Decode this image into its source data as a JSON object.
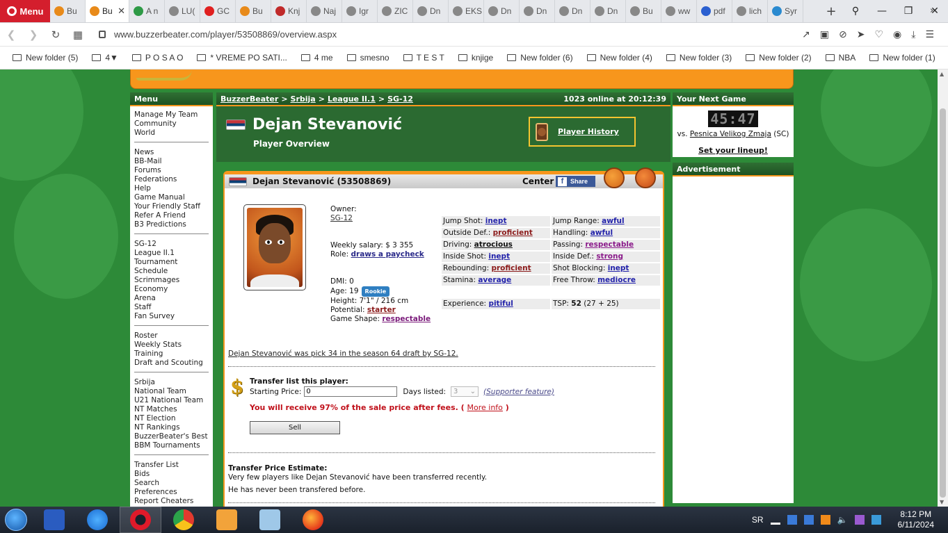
{
  "browser": {
    "menu_label": "Menu",
    "tabs": [
      {
        "label": "Bu",
        "color": "#e88a1a",
        "active": false
      },
      {
        "label": "Bu",
        "color": "#e88a1a",
        "active": true
      },
      {
        "label": "A n",
        "color": "#2e9a46",
        "active": false
      },
      {
        "label": "LU(",
        "color": "#888888",
        "active": false
      },
      {
        "label": "GC",
        "color": "#e02020",
        "active": false
      },
      {
        "label": "Bu",
        "color": "#e88a1a",
        "active": false
      },
      {
        "label": "Knj",
        "color": "#c02a2a",
        "active": false
      },
      {
        "label": "Naj",
        "color": "#888888",
        "active": false
      },
      {
        "label": "Igr",
        "color": "#888888",
        "active": false
      },
      {
        "label": "ZIC",
        "color": "#888888",
        "active": false
      },
      {
        "label": "Dn",
        "color": "#888888",
        "active": false
      },
      {
        "label": "EKS",
        "color": "#888888",
        "active": false
      },
      {
        "label": "Dn",
        "color": "#888888",
        "active": false
      },
      {
        "label": "Dn",
        "color": "#888888",
        "active": false
      },
      {
        "label": "Dn",
        "color": "#888888",
        "active": false
      },
      {
        "label": "Dn",
        "color": "#888888",
        "active": false
      },
      {
        "label": "Bu",
        "color": "#888888",
        "active": false
      },
      {
        "label": "ww",
        "color": "#888888",
        "active": false
      },
      {
        "label": "pdf",
        "color": "#2a5fd0",
        "active": false
      },
      {
        "label": "lich",
        "color": "#888888",
        "active": false
      },
      {
        "label": "Syr",
        "color": "#2a8ad0",
        "active": false
      }
    ],
    "url": "www.buzzerbeater.com/player/53508869/overview.aspx",
    "bookmarks": [
      "New folder (5)",
      "4▼",
      "P O S A O",
      "*  VREME PO SATI...",
      "4 me",
      "smesno",
      "T E S T",
      "knjige",
      "New folder (6)",
      "New folder (4)",
      "New folder (3)",
      "New folder (2)",
      "NBA",
      "New folder (1)"
    ]
  },
  "menu": {
    "header": "Menu",
    "groups": [
      [
        "Manage My Team",
        "Community",
        "World"
      ],
      [
        "News",
        "BB-Mail",
        "Forums",
        "Federations",
        "Help",
        "Game Manual",
        "Your Friendly Staff",
        "Refer A Friend",
        "B3 Predictions"
      ],
      [
        "SG-12",
        "League II.1",
        "Tournament",
        "Schedule",
        "Scrimmages",
        "Economy",
        "Arena",
        "Staff",
        "Fan Survey"
      ],
      [
        "Roster",
        "Weekly Stats",
        "Training",
        "Draft and Scouting"
      ],
      [
        "Srbija",
        "National Team",
        "U21 National Team",
        "NT Matches",
        "NT Election",
        "NT Rankings",
        "BuzzerBeater's Best",
        "BBM Tournaments"
      ],
      [
        "Transfer List",
        "Bids",
        "Search",
        "Preferences",
        "Report Cheaters"
      ]
    ]
  },
  "breadcrumb": {
    "items": [
      "BuzzerBeater",
      "Srbija",
      "League II.1",
      "SG-12"
    ],
    "separator": ">",
    "online": "1023 online at 20:12:39"
  },
  "player": {
    "name": "Dejan Stevanović",
    "subtitle": "Player Overview",
    "history_label": "Player History",
    "panel_title": "Dejan Stevanović (53508869)",
    "position": "Center",
    "share_label": "Share",
    "owner_label": "Owner:",
    "owner": "SG-12",
    "salary": "Weekly salary: $ 3 355",
    "role_label": "Role:",
    "role": "draws a paycheck",
    "dmi": "DMI: 0",
    "age": "Age: 19",
    "rookie": "Rookie",
    "height": "Height: 7'1\" / 216 cm",
    "potential_label": "Potential:",
    "potential": "starter",
    "game_shape_label": "Game Shape:",
    "game_shape": "respectable",
    "skills": [
      [
        {
          "label": "Jump Shot:",
          "value": "inept",
          "tone": "blue"
        },
        {
          "label": "Jump Range:",
          "value": "awful",
          "tone": "blue"
        }
      ],
      [
        {
          "label": "Outside Def.:",
          "value": "proficient",
          "tone": "red"
        },
        {
          "label": "Handling:",
          "value": "awful",
          "tone": "blue"
        }
      ],
      [
        {
          "label": "Driving:",
          "value": "atrocious",
          "tone": "dark"
        },
        {
          "label": "Passing:",
          "value": "respectable",
          "tone": "purple"
        }
      ],
      [
        {
          "label": "Inside Shot:",
          "value": "inept",
          "tone": "blue"
        },
        {
          "label": "Inside Def.:",
          "value": "strong",
          "tone": "purple"
        }
      ],
      [
        {
          "label": "Rebounding:",
          "value": "proficient",
          "tone": "red"
        },
        {
          "label": "Shot Blocking:",
          "value": "inept",
          "tone": "blue"
        }
      ],
      [
        {
          "label": "Stamina:",
          "value": "average",
          "tone": "blue"
        },
        {
          "label": "Free Throw:",
          "value": "mediocre",
          "tone": "blue"
        }
      ]
    ],
    "experience_label": "Experience:",
    "experience": "pitiful",
    "tsp_label": "TSP:",
    "tsp_value": "52",
    "tsp_breakdown": "(27 + 25)",
    "draft_note": "Dejan Stevanović was pick 34 in the season 64 draft by SG-12."
  },
  "transfer": {
    "title": "Transfer list this player:",
    "price_label": "Starting Price:",
    "price_value": "0",
    "days_label": "Days listed:",
    "days_value": "3",
    "supporter": "(Supporter feature)",
    "fee_note": "You will receive 97% of the sale price after fees. (",
    "more_info": "More info",
    "fee_close": ")",
    "sell_label": "Sell",
    "estimate_title": "Transfer Price Estimate:",
    "estimate_line1": "Very few players like Dejan Stevanović have been transferred recently.",
    "estimate_line2": "He has never been transfered before."
  },
  "next_game": {
    "header": "Your Next Game",
    "countdown": "45:47",
    "vs": "vs.",
    "opponent": "Pesnica Velikog Zmaja",
    "opponent_suffix": "(SC)",
    "set_lineup": "Set your lineup!"
  },
  "ad": {
    "header": "Advertisement"
  },
  "taskbar": {
    "lang": "SR",
    "time": "8:12 PM",
    "date": "6/11/2024"
  }
}
